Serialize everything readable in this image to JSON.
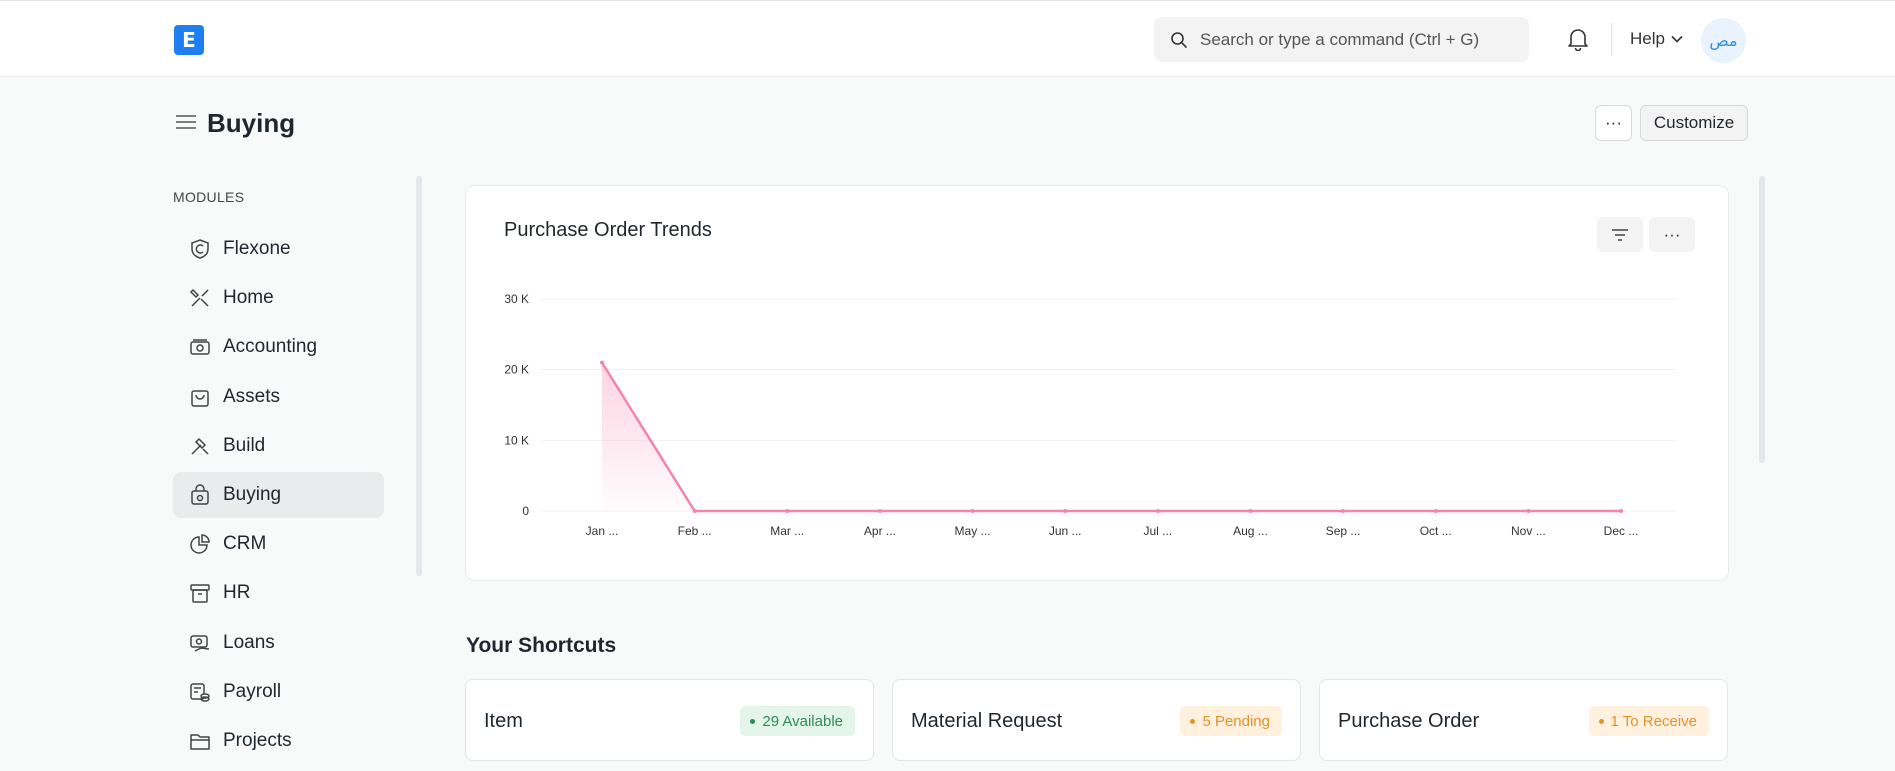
{
  "navbar": {
    "logo_letter": "E",
    "search_placeholder": "Search or type a command (Ctrl + G)",
    "help_label": "Help",
    "avatar_initials": "مص"
  },
  "page": {
    "title": "Buying",
    "more_label": "···",
    "customize_label": "Customize"
  },
  "sidebar": {
    "section_label": "MODULES",
    "items": [
      {
        "label": "Flexone",
        "icon": "shield-icon"
      },
      {
        "label": "Home",
        "icon": "tools-icon"
      },
      {
        "label": "Accounting",
        "icon": "money-icon"
      },
      {
        "label": "Assets",
        "icon": "bag-icon"
      },
      {
        "label": "Build",
        "icon": "hammer-icon"
      },
      {
        "label": "Buying",
        "icon": "buying-icon",
        "active": true
      },
      {
        "label": "CRM",
        "icon": "pie-icon"
      },
      {
        "label": "HR",
        "icon": "archive-icon"
      },
      {
        "label": "Loans",
        "icon": "loan-icon"
      },
      {
        "label": "Payroll",
        "icon": "payroll-icon"
      },
      {
        "label": "Projects",
        "icon": "folder-icon"
      }
    ]
  },
  "chart_card": {
    "title": "Purchase Order Trends",
    "more_label": "···"
  },
  "chart_data": {
    "type": "line",
    "title": "Purchase Order Trends",
    "categories": [
      "Jan ...",
      "Feb ...",
      "Mar ...",
      "Apr ...",
      "May ...",
      "Jun ...",
      "Jul ...",
      "Aug ...",
      "Sep ...",
      "Oct ...",
      "Nov ...",
      "Dec ..."
    ],
    "series": [
      {
        "values": [
          21000,
          0,
          0,
          0,
          0,
          0,
          0,
          0,
          0,
          0,
          0,
          0
        ]
      }
    ],
    "y_ticks": [
      0,
      10000,
      20000,
      30000
    ],
    "y_tick_labels": [
      "0",
      "10 K",
      "20 K",
      "30 K"
    ],
    "ylim": [
      0,
      30000
    ],
    "grid": true,
    "line_color": "#f683ae"
  },
  "shortcuts": {
    "title": "Your Shortcuts",
    "items": [
      {
        "name": "Item",
        "badge": "29 Available",
        "badge_color": "#2e8b57",
        "badge_bg": "#e4f5e9"
      },
      {
        "name": "Material Request",
        "badge": "5 Pending",
        "badge_color": "#e0922c",
        "badge_bg": "#fff1de"
      },
      {
        "name": "Purchase Order",
        "badge": "1 To Receive",
        "badge_color": "#e0922c",
        "badge_bg": "#fff1de"
      }
    ]
  }
}
